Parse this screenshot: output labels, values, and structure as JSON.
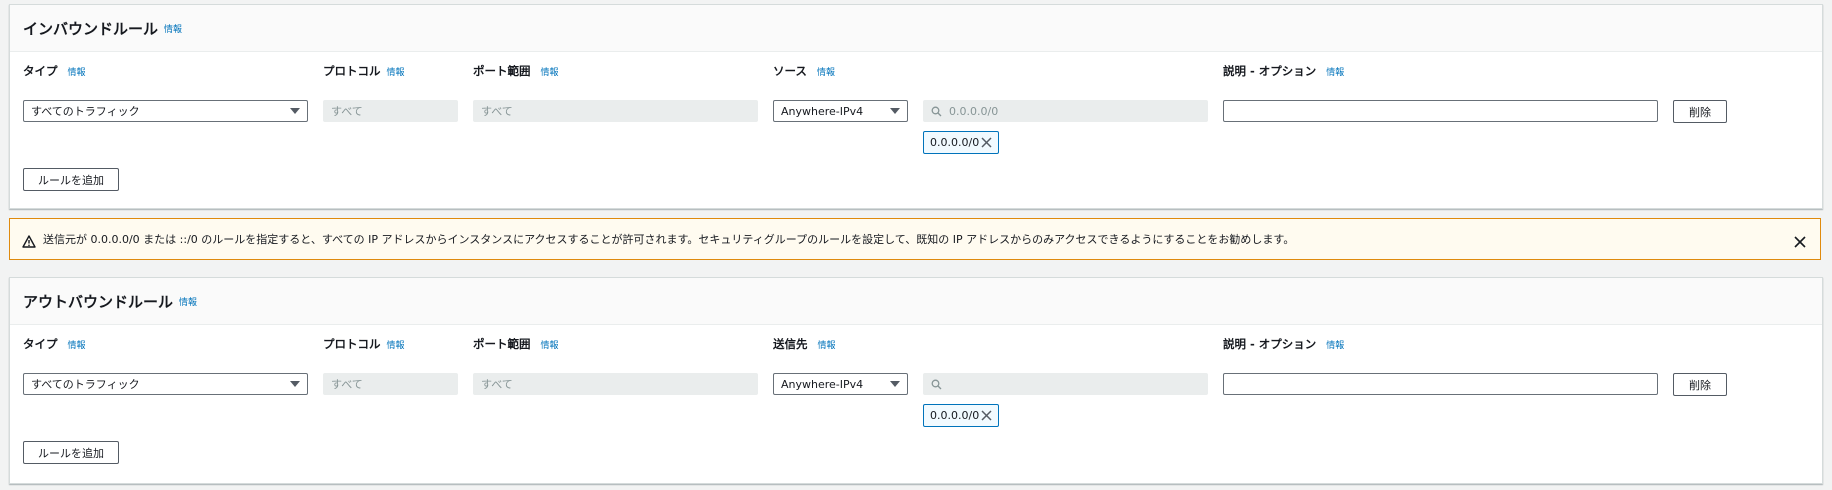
{
  "inbound": {
    "title": "インバウンドルール",
    "title_info": "情報",
    "type_label": "タイプ",
    "protocol_label": "プロトコル",
    "port_label": "ポート範囲",
    "source_label": "ソース",
    "desc_label": "説明 - オプション",
    "info": "情報",
    "type_value": "すべてのトラフィック",
    "protocol_value": "すべて",
    "port_value": "すべて",
    "source_type_value": "Anywhere-IPv4",
    "cidr_search_placeholder": "0.0.0.0/0",
    "cidr_token": "0.0.0.0/0",
    "delete_label": "削除",
    "add_rule_label": "ルールを追加"
  },
  "warning": {
    "text": "送信元が 0.0.0.0/0 または ::/0 のルールを指定すると、すべての IP アドレスからインスタンスにアクセスすることが許可されます。セキュリティグループのルールを設定して、既知の IP アドレスからのみアクセスできるようにすることをお勧めします。"
  },
  "outbound": {
    "title": "アウトバウンドルール",
    "title_info": "情報",
    "type_label": "タイプ",
    "protocol_label": "プロトコル",
    "port_label": "ポート範囲",
    "dest_label": "送信先",
    "desc_label": "説明 - オプション",
    "info": "情報",
    "type_value": "すべてのトラフィック",
    "protocol_value": "すべて",
    "port_value": "すべて",
    "dest_type_value": "Anywhere-IPv4",
    "cidr_search_placeholder": "",
    "cidr_token": "0.0.0.0/0",
    "delete_label": "削除",
    "add_rule_label": "ルールを追加"
  },
  "colors": {
    "link": "#0073bb",
    "warning_border": "#df8a0d",
    "warning_bg": "#fffbf0",
    "token_border": "#0073bb"
  }
}
